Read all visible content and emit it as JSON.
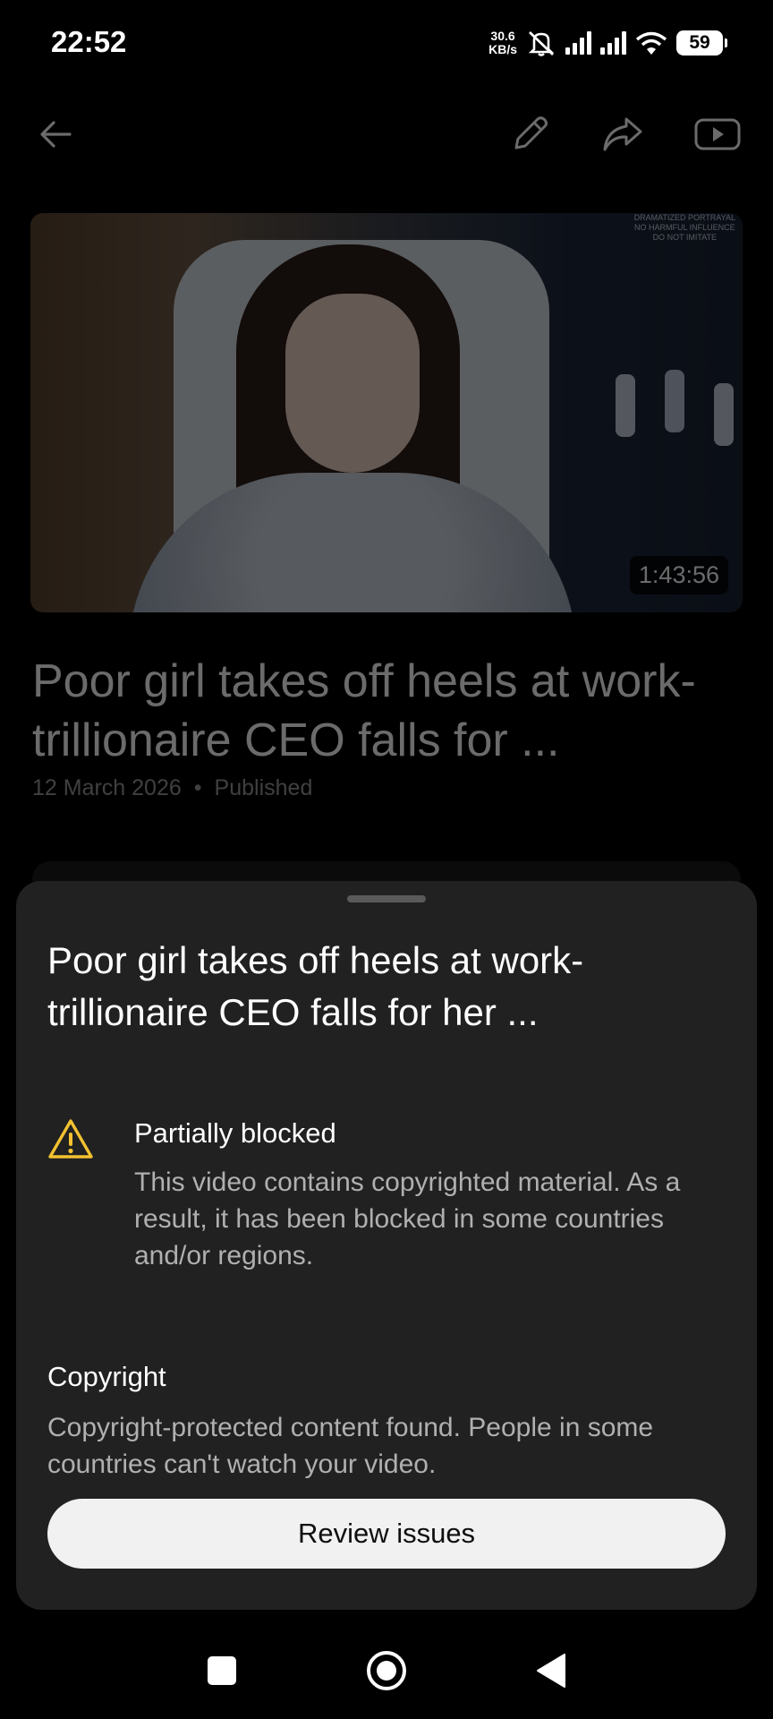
{
  "status_bar": {
    "time": "22:52",
    "net_speed_value": "30.6",
    "net_speed_unit": "KB/s",
    "battery": "59",
    "icons": [
      "mute-icon",
      "signal-icon",
      "signal-icon",
      "wifi-icon",
      "battery-icon"
    ]
  },
  "toolbar": {
    "icons": [
      "back-arrow-icon",
      "edit-pencil-icon",
      "share-icon",
      "youtube-icon"
    ]
  },
  "video": {
    "duration": "1:43:56",
    "title": "Poor girl takes off heels at work-trillionaire CEO falls for ...",
    "date": "12 March 2026",
    "separator": "•",
    "status": "Published",
    "thumbnail_watermark_1": "DRAMATIZED PORTRAYAL",
    "thumbnail_watermark_2": "NO HARMFUL INFLUENCE",
    "thumbnail_watermark_3": "DO NOT IMITATE"
  },
  "sheet": {
    "title": "Poor girl takes off heels at work-trillionaire CEO falls for her ...",
    "issue": {
      "title": "Partially blocked",
      "description": "This video contains copyrighted material. As a result, it has been blocked in some countries and/or regions.",
      "icon": "warning-icon"
    },
    "copyright": {
      "title": "Copyright",
      "description": "Copyright-protected content found. People in some countries can't watch your video."
    },
    "button_label": "Review issues"
  },
  "nav": {
    "icons": [
      "recents-square-icon",
      "home-circle-icon",
      "back-triangle-icon"
    ]
  },
  "colors": {
    "background": "#000000",
    "sheet": "#212121",
    "warning": "#f2c230",
    "button": "#f1f1f1"
  }
}
